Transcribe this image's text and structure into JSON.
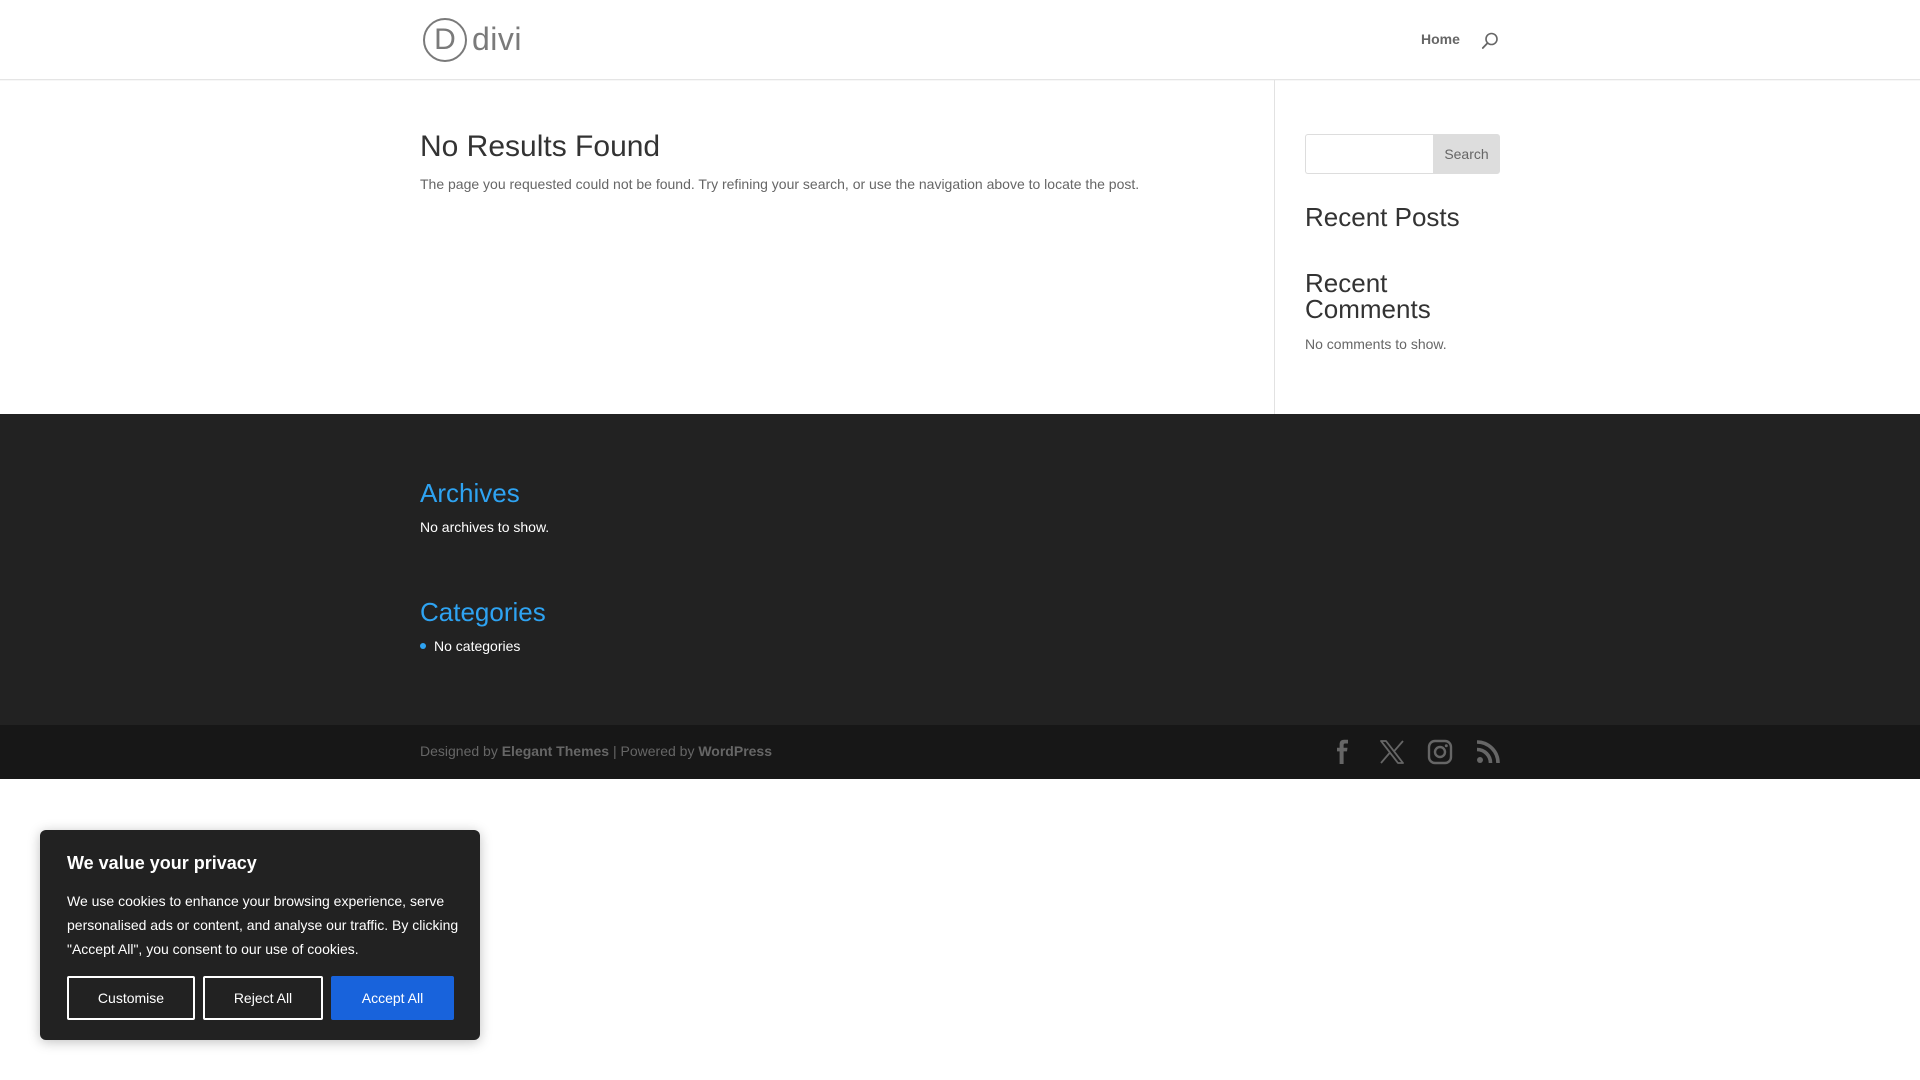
{
  "header": {
    "logo_letter": "D",
    "logo_text": "divi",
    "nav_home": "Home"
  },
  "main": {
    "title": "No Results Found",
    "message": "The page you requested could not be found. Try refining your search, or use the navigation above to locate the post."
  },
  "sidebar": {
    "search_button": "Search",
    "search_value": "",
    "recent_posts_title": "Recent Posts",
    "recent_comments_title": "Recent Comments",
    "no_comments": "No comments to show."
  },
  "footer": {
    "archives_title": "Archives",
    "archives_text": "No archives to show.",
    "categories_title": "Categories",
    "categories_item": "No categories",
    "credits_prefix": "Designed by",
    "credits_elegant": "Elegant Themes",
    "credits_sep": "| Powered by",
    "credits_wp": "WordPress",
    "social_icons": [
      "facebook-icon",
      "x-icon",
      "instagram-icon",
      "rss-icon"
    ]
  },
  "cookie": {
    "title": "We value your privacy",
    "text": "We use cookies to enhance your browsing experience, serve personalised ads or content, and analyse our traffic. By clicking \"Accept All\", you consent to our use of cookies.",
    "customise": "Customise",
    "reject": "Reject All",
    "accept": "Accept All"
  },
  "colors": {
    "accent": "#2ea3f2",
    "footer_bg": "#222222",
    "bottom_bar_bg": "#171717",
    "accept_button": "#1863dc"
  }
}
